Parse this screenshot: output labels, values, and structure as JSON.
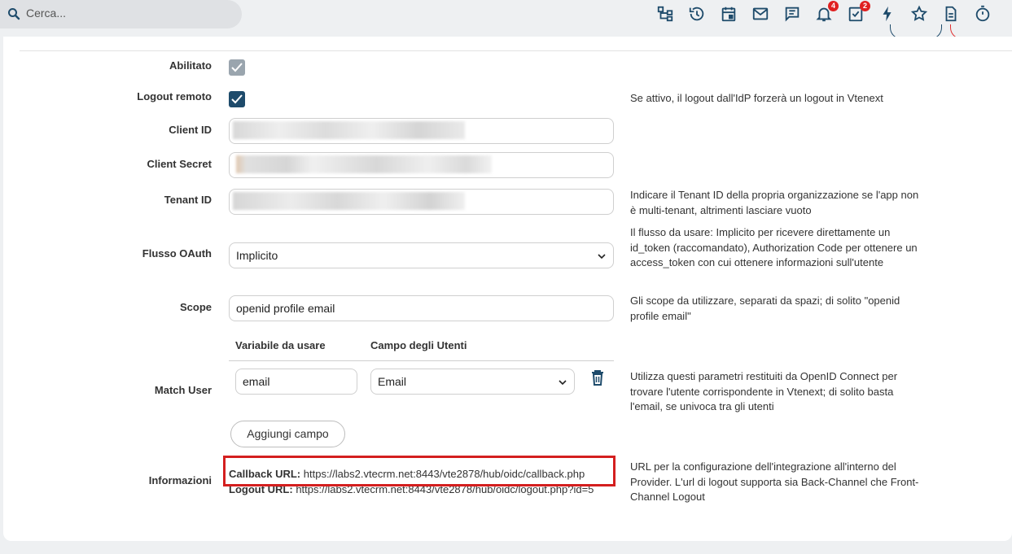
{
  "search": {
    "placeholder": "Cerca..."
  },
  "topbar": {
    "icons": [
      {
        "name": "sitemap-icon"
      },
      {
        "name": "history-icon"
      },
      {
        "name": "calendar-icon"
      },
      {
        "name": "mail-icon"
      },
      {
        "name": "chat-icon"
      },
      {
        "name": "bell-icon",
        "badge": "4"
      },
      {
        "name": "tasks-icon",
        "badge": "2"
      },
      {
        "name": "bolt-icon"
      },
      {
        "name": "star-icon"
      },
      {
        "name": "document-icon"
      },
      {
        "name": "timer-icon"
      }
    ],
    "badge_color": "#e02020"
  },
  "form": {
    "enabled": {
      "label": "Abilitato",
      "checked": true
    },
    "remote_logout": {
      "label": "Logout remoto",
      "checked": true,
      "help": "Se attivo, il logout dall'IdP forzerà un logout in Vtenext"
    },
    "client_id": {
      "label": "Client ID"
    },
    "client_secret": {
      "label": "Client Secret"
    },
    "tenant_id": {
      "label": "Tenant ID",
      "help": "Indicare il Tenant ID della propria organizzazione se l'app non è multi-tenant, altrimenti lasciare vuoto"
    },
    "oauth_flow": {
      "label": "Flusso OAuth",
      "value": "Implicito",
      "help": "Il flusso da usare: Implicito per ricevere direttamente un id_token (raccomandato), Authorization Code per ottenere un access_token con cui ottenere informazioni sull'utente"
    },
    "scope": {
      "label": "Scope",
      "value": "openid profile email",
      "help": "Gli scope da utilizzare, separati da spazi; di solito \"openid profile email\""
    },
    "match_user": {
      "label": "Match User",
      "col_variable": "Variabile da usare",
      "col_user_field": "Campo degli Utenti",
      "rows": [
        {
          "variable": "email",
          "user_field": "Email"
        }
      ],
      "add_button": "Aggiungi campo",
      "help": "Utilizza questi parametri restituiti da OpenID Connect per trovare l'utente corrispondente in Vtenext; di solito basta l'email, se univoca tra gli utenti"
    },
    "info": {
      "label": "Informazioni",
      "callback_label": "Callback URL:",
      "callback_url": "https://labs2.vtecrm.net:8443/vte2878/hub/oidc/callback.php",
      "logout_label": "Logout URL:",
      "logout_url": "https://labs2.vtecrm.net:8443/vte2878/hub/oidc/logout.php?id=5",
      "help": "URL per la configurazione dell'integrazione all'interno del Provider. L'url di logout supporta sia Back-Channel che Front-Channel Logout"
    }
  },
  "colors": {
    "accent": "#1e4b6b",
    "checkbox_disabled": "#9aa5ae",
    "highlight": "#d41f1f"
  }
}
